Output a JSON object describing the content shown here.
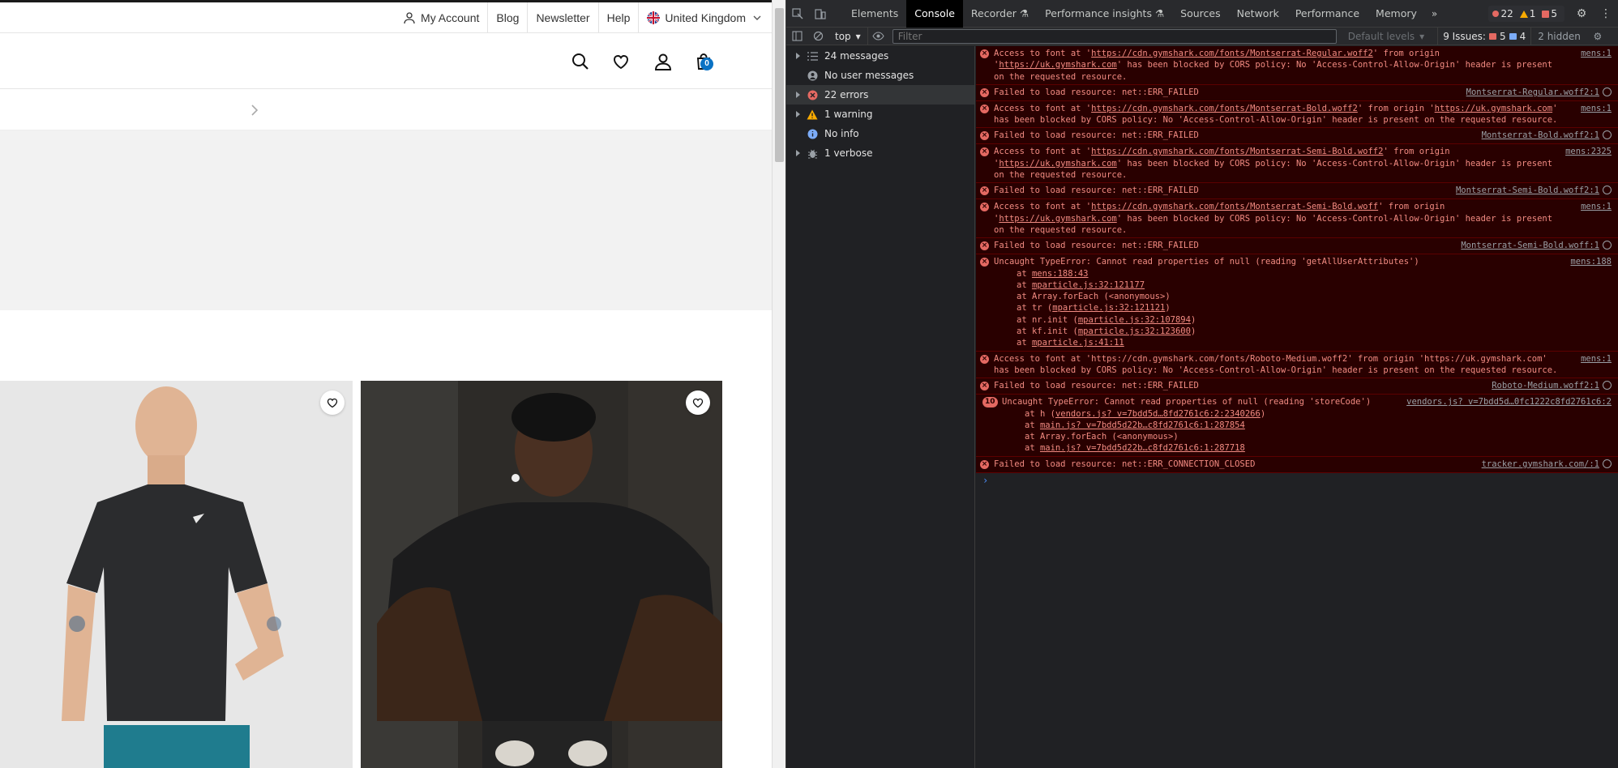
{
  "site": {
    "utility_nav": [
      {
        "label": "My Account",
        "icon": "user-icon"
      },
      {
        "label": "Blog"
      },
      {
        "label": "Newsletter"
      },
      {
        "label": "Help"
      },
      {
        "label": "United Kingdom",
        "icon": "uk-flag-icon"
      }
    ],
    "bag_count": "0",
    "colors": {
      "accent": "#0a72c4"
    }
  },
  "devtools": {
    "tabs": [
      "Elements",
      "Console",
      "Recorder",
      "Performance insights",
      "Sources",
      "Network",
      "Performance",
      "Memory"
    ],
    "active_tab": "Console",
    "counts": {
      "errors": "22",
      "warnings": "1",
      "issues": "5"
    },
    "toolbar": {
      "context": "top",
      "filter_placeholder": "Filter",
      "levels": "Default levels",
      "issues_label": "9 Issues:",
      "issues_errors": "5",
      "issues_info": "4",
      "hidden": "2 hidden"
    },
    "sidebar": [
      {
        "label": "24 messages",
        "icon": "list-icon"
      },
      {
        "label": "No user messages",
        "icon": "user-circle-icon"
      },
      {
        "label": "22 errors",
        "icon": "error-icon"
      },
      {
        "label": "1 warning",
        "icon": "warning-icon"
      },
      {
        "label": "No info",
        "icon": "info-icon"
      },
      {
        "label": "1 verbose",
        "icon": "bug-icon"
      }
    ],
    "messages": [
      {
        "t": "cors",
        "pre": "Access to font at '",
        "url": "https://cdn.gymshark.com/fonts/Montserrat-Regular.woff2",
        "mid": "' from origin '",
        "origin": "https://uk.gymshark.com",
        "post": "' has been blocked by CORS policy: No 'Access-Control-Allow-Origin' header is present on the requested resource.",
        "src": "mens:1"
      },
      {
        "t": "fail",
        "text": "Failed to load resource: net::ERR_FAILED",
        "src": "Montserrat-Regular.woff2:1"
      },
      {
        "t": "cors",
        "pre": "Access to font at '",
        "url": "https://cdn.gymshark.com/fonts/Montserrat-Bold.woff2",
        "mid": "' from origin '",
        "origin": "https://uk.gymshark.com",
        "post": "' has been blocked by CORS policy: No 'Access-Control-Allow-Origin' header is present on the requested resource.",
        "src": "mens:1"
      },
      {
        "t": "fail",
        "text": "Failed to load resource: net::ERR_FAILED",
        "src": "Montserrat-Bold.woff2:1"
      },
      {
        "t": "cors",
        "pre": "Access to font at '",
        "url": "https://cdn.gymshark.com/fonts/Montserrat-Semi-Bold.woff2",
        "mid": "' from origin '",
        "origin": "https://uk.gymshark.com",
        "post": "' has been blocked by CORS policy: No 'Access-Control-Allow-Origin' header is present on the requested resource.",
        "src": "mens:2325"
      },
      {
        "t": "fail",
        "text": "Failed to load resource: net::ERR_FAILED",
        "src": "Montserrat-Semi-Bold.woff2:1"
      },
      {
        "t": "cors",
        "pre": "Access to font at '",
        "url": "https://cdn.gymshark.com/fonts/Montserrat-Semi-Bold.woff",
        "mid": "' from origin '",
        "origin": "https://uk.gymshark.com",
        "post": "' has been blocked by CORS policy: No 'Access-Control-Allow-Origin' header is present on the requested resource.",
        "src": "mens:1"
      },
      {
        "t": "fail",
        "text": "Failed to load resource: net::ERR_FAILED",
        "src": "Montserrat-Semi-Bold.woff:1"
      },
      {
        "t": "stack",
        "text": "Uncaught TypeError: Cannot read properties of null (reading 'getAllUserAttributes')",
        "src": "mens:188",
        "frames": [
          {
            "pre": "at ",
            "link": "mens:188:43",
            "post": ""
          },
          {
            "pre": "at ",
            "link": "mparticle.js:32:121177",
            "post": ""
          },
          {
            "pre": "at Array.forEach (<anonymous>)",
            "link": "",
            "post": ""
          },
          {
            "pre": "at tr (",
            "link": "mparticle.js:32:121121",
            "post": ")"
          },
          {
            "pre": "at nr.init (",
            "link": "mparticle.js:32:107894",
            "post": ")"
          },
          {
            "pre": "at kf.init (",
            "link": "mparticle.js:32:123600",
            "post": ")"
          },
          {
            "pre": "at ",
            "link": "mparticle.js:41:11",
            "post": ""
          }
        ]
      },
      {
        "t": "cors",
        "pre": "Access to font at '",
        "url": "https://cdn.gymshark.com/fonts/Roboto-Medium.woff2",
        "mid": "' from origin '",
        "origin": "https://uk.gymshark.com",
        "post": "' has been blocked by CORS policy: No 'Access-Control-Allow-Origin' header is present on the requested resource.",
        "src": "mens:1",
        "plain": true
      },
      {
        "t": "fail",
        "text": "Failed to load resource: net::ERR_FAILED",
        "src": "Roboto-Medium.woff2:1"
      },
      {
        "t": "stack",
        "repeat": "10",
        "text": "Uncaught TypeError: Cannot read properties of null (reading 'storeCode')",
        "src": "vendors.js? v=7bdd5d…0fc1222c8fd2761c6:2",
        "frames": [
          {
            "pre": "at h (",
            "link": "vendors.js? v=7bdd5d…8fd2761c6:2:2340266",
            "post": ")"
          },
          {
            "pre": "at ",
            "link": "main.js? v=7bdd5d22b…c8fd2761c6:1:287854",
            "post": ""
          },
          {
            "pre": "at Array.forEach (<anonymous>)",
            "link": "",
            "post": ""
          },
          {
            "pre": "at ",
            "link": "main.js? v=7bdd5d22b…c8fd2761c6:1:287718",
            "post": ""
          }
        ]
      },
      {
        "t": "fail",
        "text": "Failed to load resource: net::ERR_CONNECTION_CLOSED",
        "src": "tracker.gymshark.com/:1"
      }
    ],
    "colors": {
      "error_bg": "#290000",
      "error_text": "#f28b82",
      "panel_bg": "#202124"
    }
  }
}
